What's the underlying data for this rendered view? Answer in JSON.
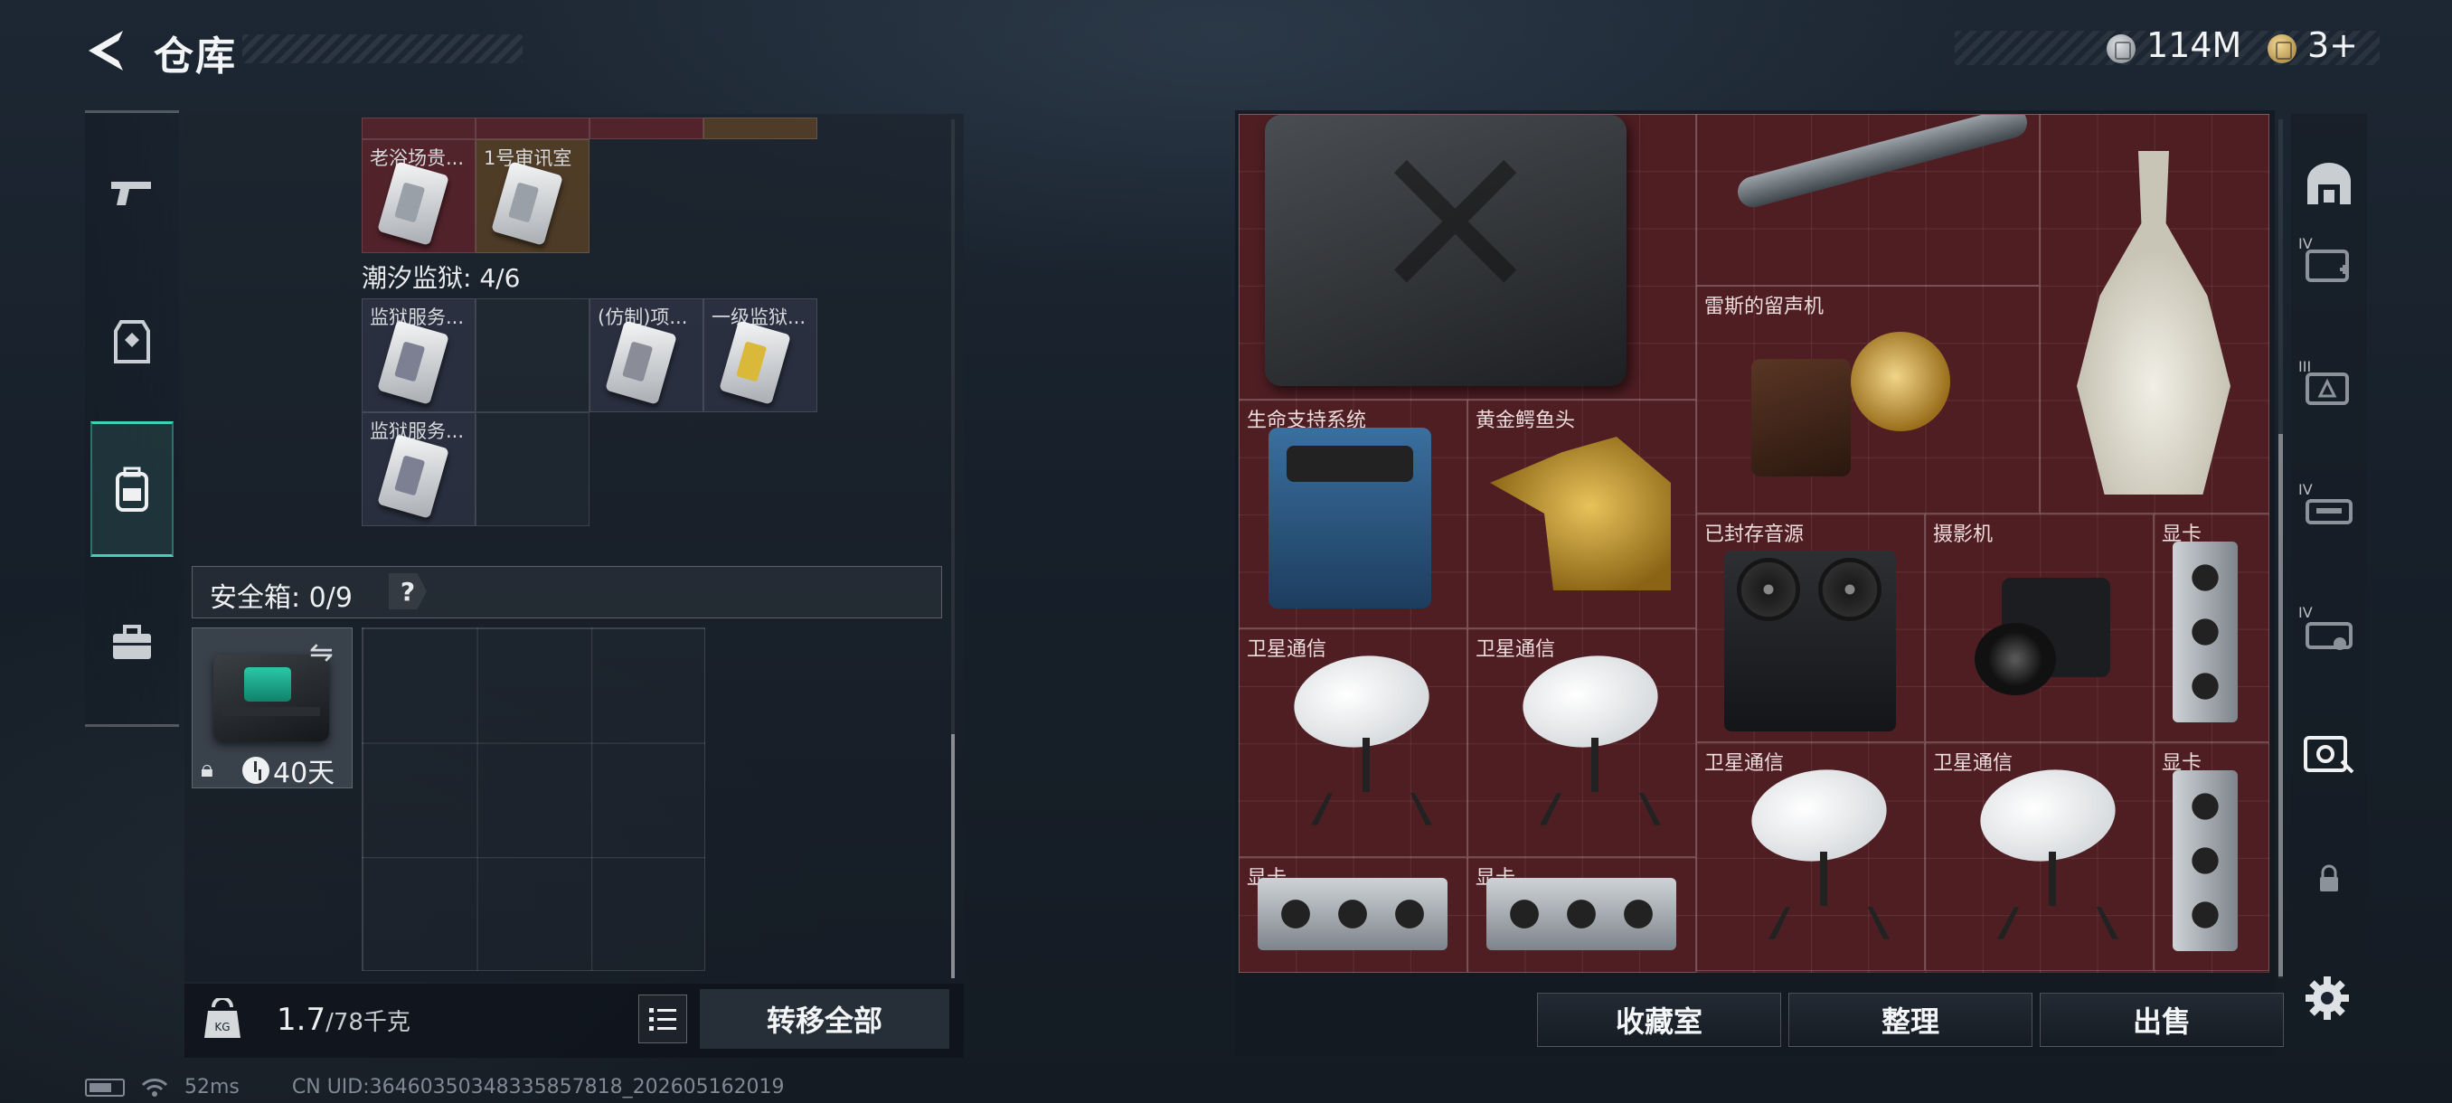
{
  "header": {
    "title": "仓库",
    "currency_silver": "114M",
    "currency_gold": "3+"
  },
  "left_rail": {
    "tabs": [
      {
        "icon": "gun-icon"
      },
      {
        "icon": "armor-icon"
      },
      {
        "icon": "backpack-icon",
        "active": true
      },
      {
        "icon": "toolbox-icon"
      }
    ]
  },
  "container": {
    "top_row_labels": [
      "老浴场贵...",
      "1号审讯室"
    ],
    "section_title": "潮汐监狱: 4/6",
    "prison_cards": [
      "监狱服务...",
      "(仿制)项...",
      "一级监狱...",
      "监狱服务..."
    ],
    "safebox_label": "安全箱: 0/9",
    "help": "?",
    "case_timer": "40天"
  },
  "bottom_left": {
    "weight": "1.7",
    "weight_capacity": "/78千克",
    "transfer_all": "转移全部"
  },
  "stash": {
    "items": {
      "gramophone": "雷斯的留声机",
      "life_support": "生命支持系统",
      "gold_croc": "黄金鳄鱼头",
      "sealed_audio": "已封存音源",
      "camera": "摄影机",
      "gpu": "显卡",
      "satellite": "卫星通信"
    }
  },
  "bottom_right": {
    "collection": "收藏室",
    "sort": "整理",
    "sell": "出售"
  },
  "right_rail": {
    "roman_labels": [
      "IV",
      "III",
      "IV",
      "IV"
    ]
  },
  "status": {
    "ping": "52ms",
    "uid": "CN UID:3646035034833585781​8_202605162019"
  },
  "colors": {
    "accent_teal": "#3fd0b8",
    "stash_red": "#4a1f24",
    "gold": "#f3d896"
  }
}
